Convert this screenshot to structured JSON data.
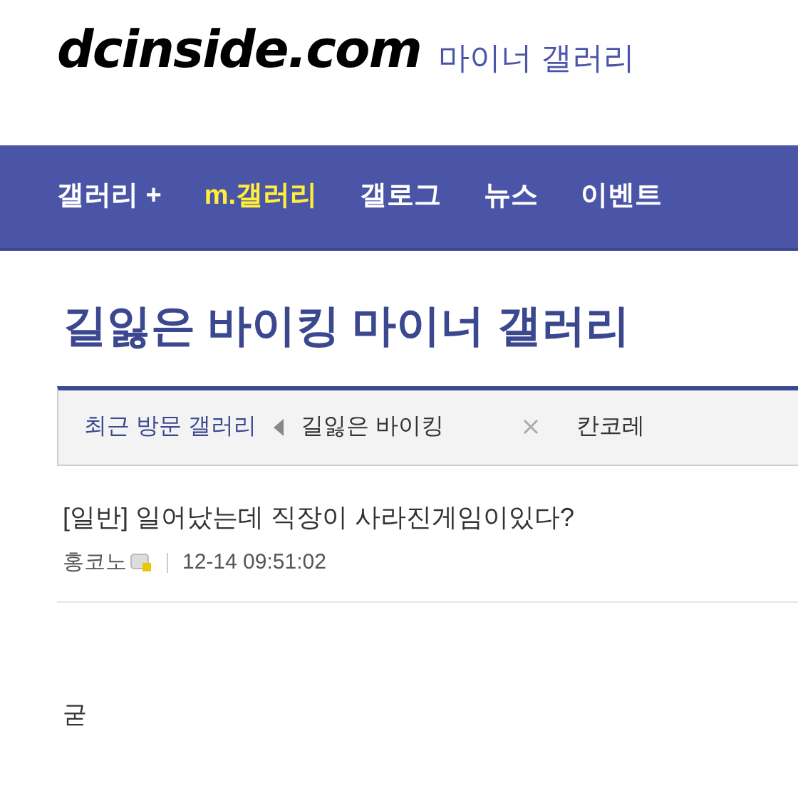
{
  "header": {
    "logo": "dcinside.com",
    "subtitle": "마이너 갤러리"
  },
  "nav": [
    {
      "label": "갤러리 +",
      "selected": false
    },
    {
      "label": "m.갤러리",
      "selected": true
    },
    {
      "label": "갤로그",
      "selected": false
    },
    {
      "label": "뉴스",
      "selected": false
    },
    {
      "label": "이벤트",
      "selected": false
    }
  ],
  "gallery_title": "길잃은 바이킹 마이너 갤러리",
  "recent": {
    "label": "최근 방문 갤러리",
    "items": [
      {
        "name": "길잃은 바이킹",
        "closable": true
      },
      {
        "name": "칸코레",
        "closable": false
      }
    ]
  },
  "post": {
    "title": "[일반] 일어났는데 직장이 사라진게임이있다?",
    "author": "홍코노",
    "date": "12-14 09:51:02",
    "body": "굳"
  }
}
